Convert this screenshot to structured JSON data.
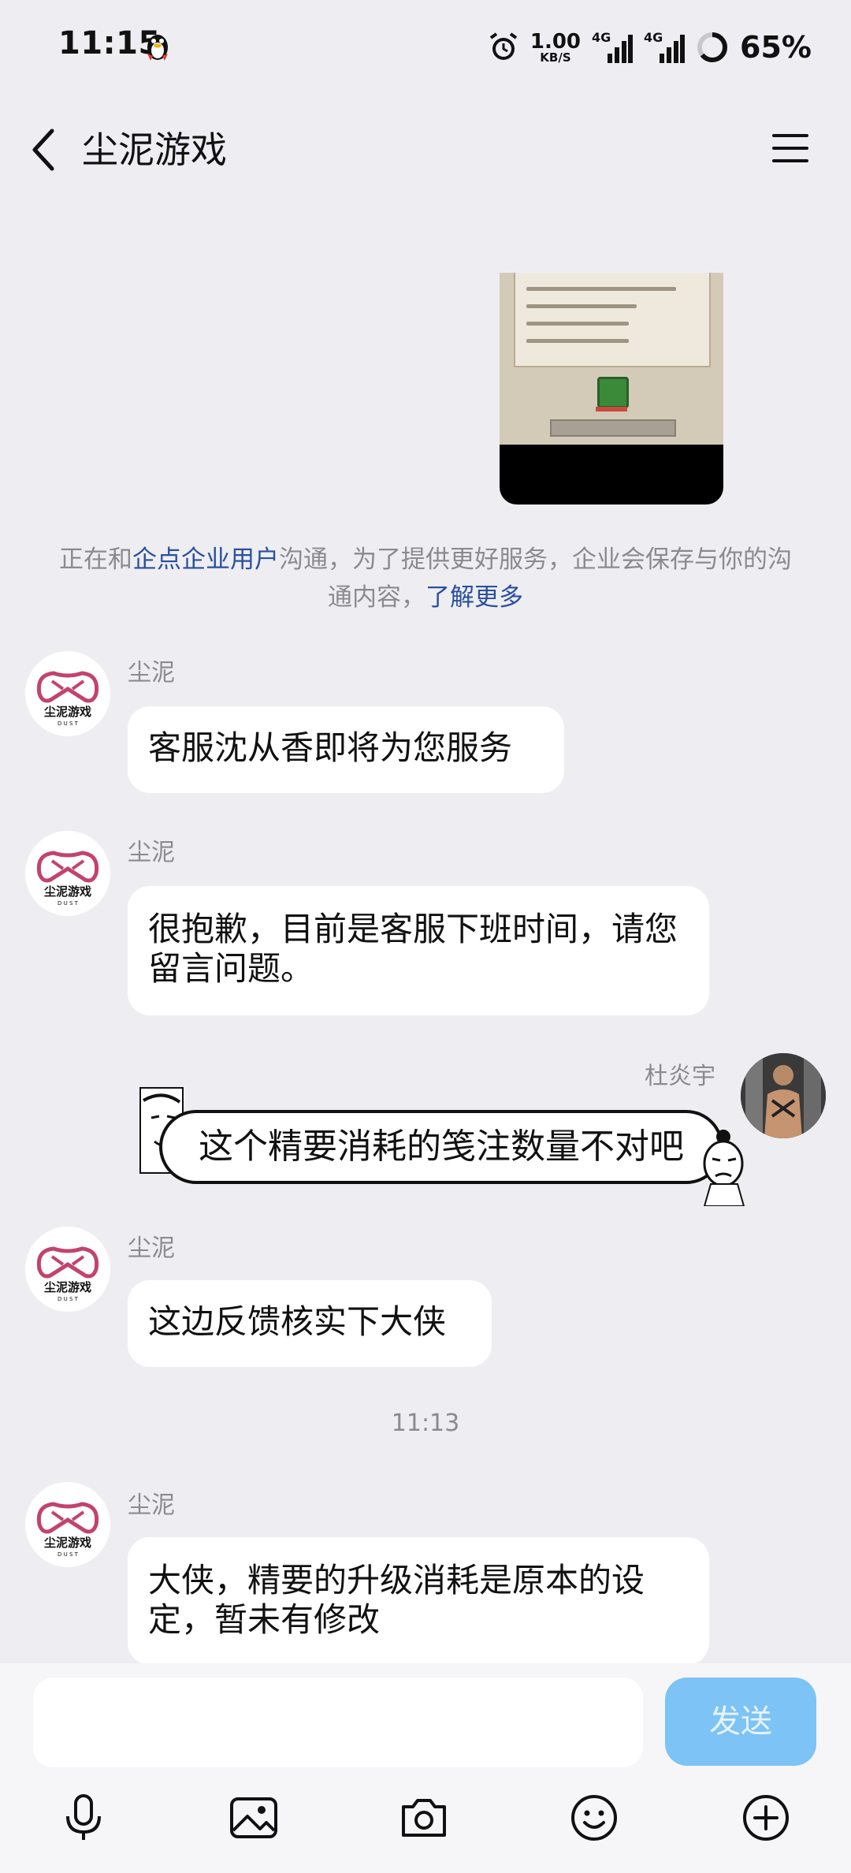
{
  "status_bar": {
    "time": "11:15",
    "net_speed_value": "1.00",
    "net_speed_unit": "KB/S",
    "signal_label_1": "4G",
    "signal_label_2": "4G",
    "battery": "65%"
  },
  "header": {
    "title": "尘泥游戏"
  },
  "notice": {
    "prefix": "正在和",
    "link_enterprise": "企点企业用户",
    "middle": "沟通，为了提供更好服务，企业会保存与你的沟通内容，",
    "link_more": "了解更多"
  },
  "logo_text": "尘泥游戏",
  "logo_sub": "D U S T",
  "messages": [
    {
      "sender": "尘泥",
      "text": "客服沈从香即将为您服务"
    },
    {
      "sender": "尘泥",
      "text": "很抱歉，目前是客服下班时间，请您留言问题。"
    },
    {
      "sender": "杜炎宇",
      "text": "这个精要消耗的笺注数量不对吧"
    },
    {
      "sender": "尘泥",
      "text": "这边反馈核实下大侠"
    },
    {
      "sender": "尘泥",
      "text": "大侠，精要的升级消耗是原本的设定，暂未有修改"
    }
  ],
  "timestamp": "11:13",
  "input": {
    "placeholder": "",
    "send_label": "发送"
  },
  "toolbar": [
    "microphone-icon",
    "image-icon",
    "camera-icon",
    "emoji-icon",
    "plus-icon"
  ]
}
